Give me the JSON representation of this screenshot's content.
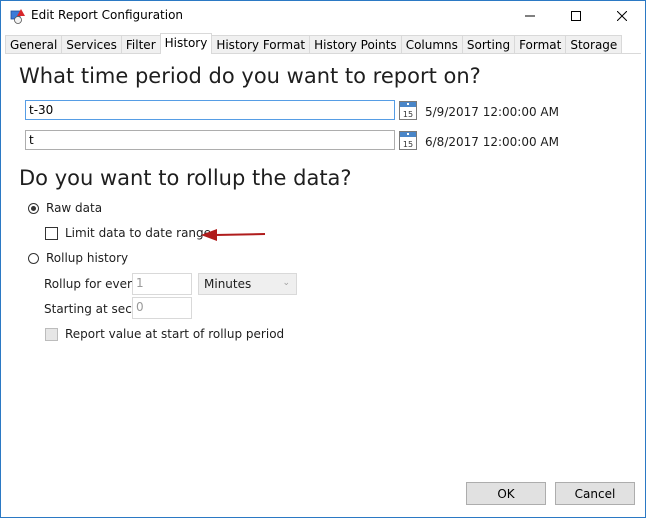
{
  "window": {
    "title": "Edit Report Configuration",
    "app_icon": "report-config-icon",
    "controls": {
      "minimize": "minimize-icon",
      "maximize": "maximize-icon",
      "close": "close-icon"
    }
  },
  "tabs": [
    {
      "label": "General",
      "active": false
    },
    {
      "label": "Services",
      "active": false
    },
    {
      "label": "Filter",
      "active": false
    },
    {
      "label": "History",
      "active": true
    },
    {
      "label": "History Format",
      "active": false
    },
    {
      "label": "History Points",
      "active": false
    },
    {
      "label": "Columns",
      "active": false
    },
    {
      "label": "Sorting",
      "active": false
    },
    {
      "label": "Format",
      "active": false
    },
    {
      "label": "Storage",
      "active": false
    }
  ],
  "time_period": {
    "heading": "What time period do you want to report on?",
    "start": {
      "value": "t-30",
      "resolved": "5/9/2017 12:00:00 AM",
      "calendar_icon": "calendar-icon",
      "calendar_day": "15"
    },
    "end": {
      "value": "t",
      "resolved": "6/8/2017 12:00:00 AM",
      "calendar_icon": "calendar-icon",
      "calendar_day": "15"
    }
  },
  "rollup": {
    "heading": "Do you want to rollup the data?",
    "raw_data": {
      "label": "Raw data",
      "selected": true
    },
    "limit_to_date_range": {
      "label": "Limit data to date range",
      "checked": false
    },
    "rollup_history": {
      "label": "Rollup history",
      "selected": false
    },
    "rollup_every_label": "Rollup for every",
    "rollup_every_value": "1",
    "rollup_unit": "Minutes",
    "starting_at_label": "Starting at second",
    "starting_at_value": "0",
    "report_start_value": {
      "label": "Report value at start of rollup period",
      "checked": false,
      "enabled": false
    }
  },
  "annotation": {
    "arrow_color": "#b01c1c"
  },
  "buttons": {
    "ok": "OK",
    "cancel": "Cancel"
  }
}
